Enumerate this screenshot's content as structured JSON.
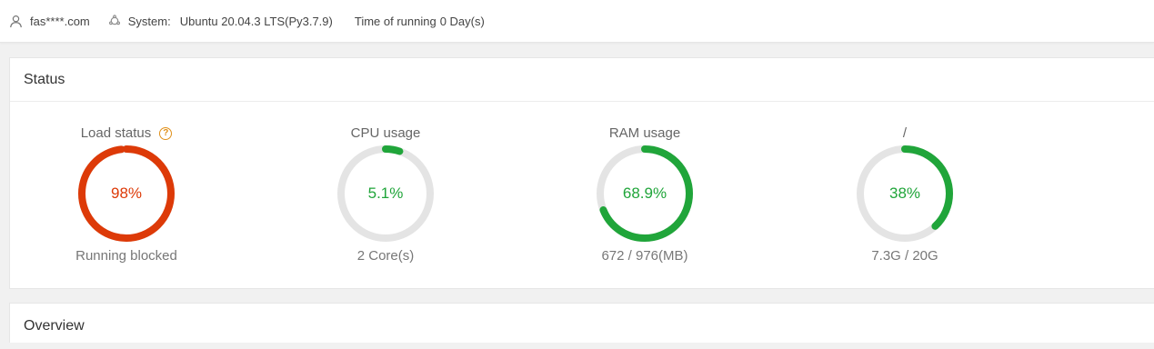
{
  "topbar": {
    "user": "fas****.com",
    "system_label": "System:",
    "system_value": "Ubuntu 20.04.3 LTS(Py3.7.9)",
    "runtime_label": "Time of running",
    "runtime_value": "0 Day(s)"
  },
  "status": {
    "title": "Status",
    "gauges": [
      {
        "title": "Load status",
        "value_text": "98%",
        "fraction": 0.98,
        "subtitle": "Running blocked",
        "color": "#dd3a08",
        "has_help": true
      },
      {
        "title": "CPU usage",
        "value_text": "5.1%",
        "fraction": 0.051,
        "subtitle": "2 Core(s)",
        "color": "#20a53a",
        "has_help": false
      },
      {
        "title": "RAM usage",
        "value_text": "68.9%",
        "fraction": 0.689,
        "subtitle": "672 / 976(MB)",
        "color": "#20a53a",
        "has_help": false
      },
      {
        "title": "/",
        "value_text": "38%",
        "fraction": 0.38,
        "subtitle": "7.3G / 20G",
        "color": "#20a53a",
        "has_help": false
      }
    ]
  },
  "overview": {
    "title": "Overview"
  },
  "colors": {
    "ok": "#20a53a",
    "danger": "#dd3a08",
    "warning": "#e0901a",
    "track": "#e4e4e4"
  },
  "icons": {
    "user": "user-icon",
    "system": "ubuntu-icon",
    "help": "help-icon"
  }
}
